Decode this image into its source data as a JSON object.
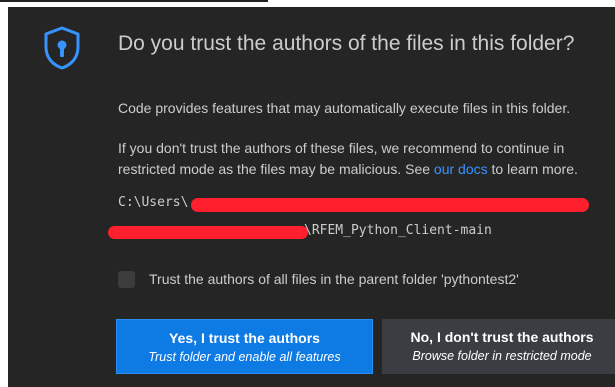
{
  "dialog": {
    "title": "Do you trust the authors of the files in this folder?",
    "message1": "Code provides features that may automatically execute files in this folder.",
    "message2_line1": "If you don't trust the authors of these files, we recommend to continue in",
    "message2_line2_before": "restricted mode as the files may be malicious. See ",
    "message2_link": "our docs",
    "message2_line2_after": " to learn more.",
    "path_line1": "C:\\Users\\",
    "path_line2": "\\RFEM_Python_Client-main",
    "checkbox_label": "Trust the authors of all files in the parent folder 'pythontest2'",
    "yes_button": {
      "label": "Yes, I trust the authors",
      "sublabel": "Trust folder and enable all features"
    },
    "no_button": {
      "label": "No, I don't trust the authors",
      "sublabel": "Browse folder in restricted mode"
    }
  },
  "colors": {
    "background": "#252526",
    "text": "#cccccc",
    "accent": "#3794ff",
    "primary_button": "#0e7ae4",
    "secondary_button": "#3a3d41",
    "redaction": "#ff1f2d"
  },
  "icons": {
    "shield": "shield-lock-icon"
  }
}
